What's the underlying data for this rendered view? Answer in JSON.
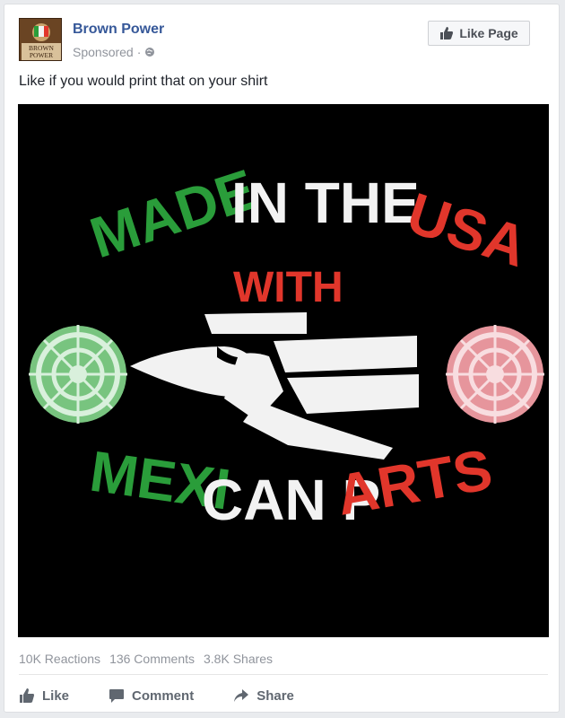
{
  "post": {
    "page_name": "Brown Power",
    "sponsored": "Sponsored",
    "separator": "·",
    "like_page_label": "Like Page",
    "text": "Like if you would print that on your shirt",
    "avatar_text_top": "BROWN",
    "avatar_text_bottom": "POWER"
  },
  "image": {
    "line1_word1": "MADE",
    "line1_word2": "IN THE",
    "line1_word3": "USA",
    "line2": "WITH",
    "line3_part1": "MEXI",
    "line3_part2": "CAN P",
    "line3_part3": "ARTS"
  },
  "stats": {
    "reactions": "10K Reactions",
    "comments": "136 Comments",
    "shares": "3.8K Shares"
  },
  "actions": {
    "like": "Like",
    "comment": "Comment",
    "share": "Share"
  },
  "colors": {
    "green": "#2a9d3a",
    "white": "#f2f2f2",
    "red": "#e1362b",
    "link_blue": "#365899"
  }
}
